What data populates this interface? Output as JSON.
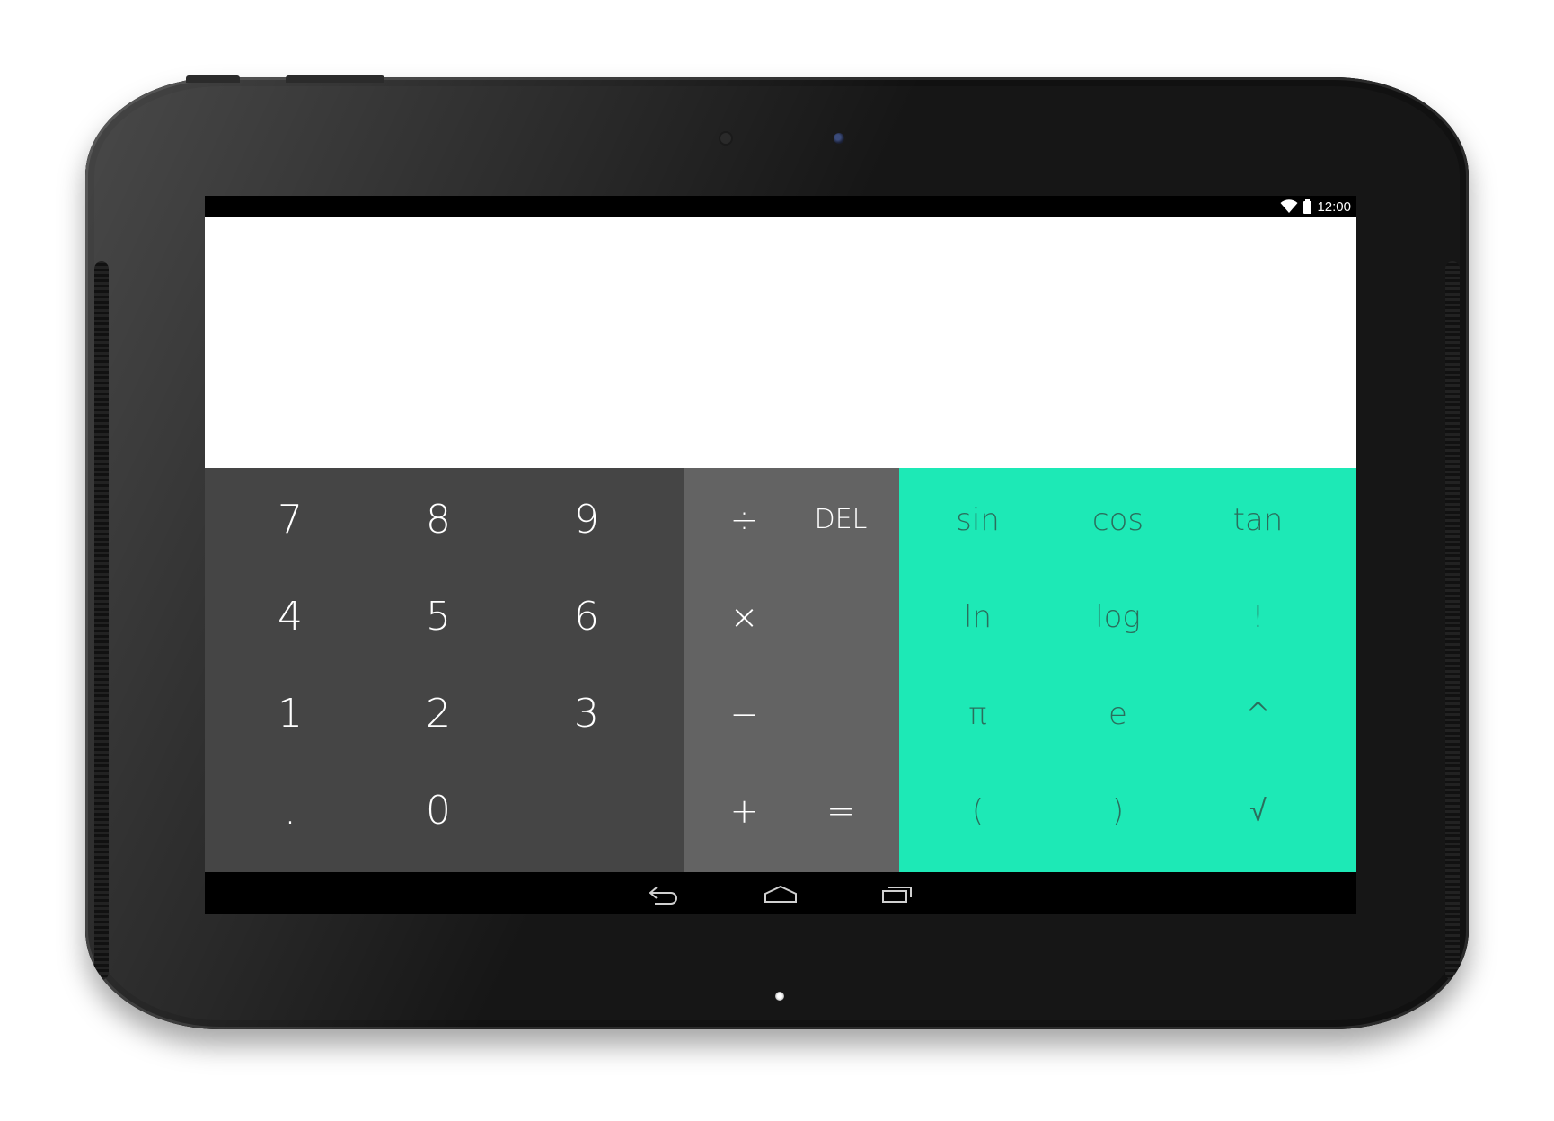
{
  "status_bar": {
    "time": "12:00",
    "icons": [
      "wifi-icon",
      "battery-icon"
    ]
  },
  "display": {
    "expression": "",
    "result": ""
  },
  "numpad": {
    "keys": [
      "7",
      "8",
      "9",
      "4",
      "5",
      "6",
      "1",
      "2",
      "3",
      ".",
      "0"
    ]
  },
  "operators": {
    "divide": "÷",
    "delete": "DEL",
    "multiply": "×",
    "minus": "−",
    "plus": "+",
    "equals": "="
  },
  "advanced": {
    "keys": [
      "sin",
      "cos",
      "tan",
      "ln",
      "log",
      "!",
      "π",
      "e",
      "^",
      "(",
      ")",
      "√"
    ]
  },
  "navigation": {
    "icons": [
      "back-icon",
      "home-icon",
      "recent-apps-icon"
    ]
  },
  "colors": {
    "numpad_bg": "#454545",
    "operator_bg": "#636363",
    "advanced_bg": "#1de9b6",
    "advanced_text": "#2a6e5c",
    "display_bg": "#ffffff"
  }
}
